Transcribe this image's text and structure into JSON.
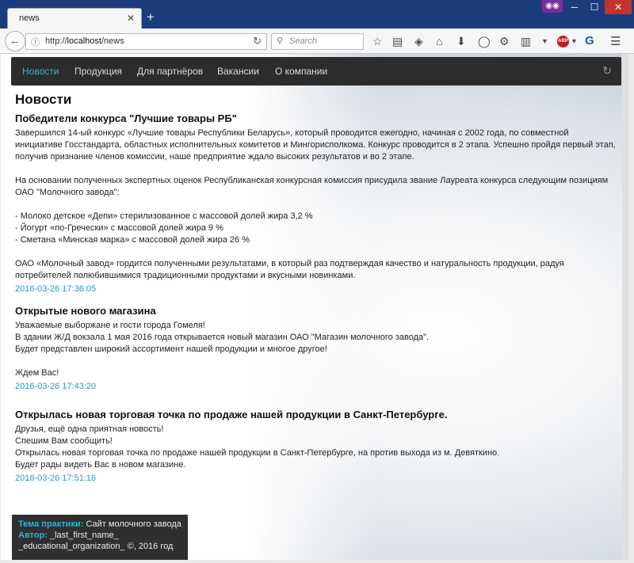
{
  "browser": {
    "tab_title": "news",
    "tab_close": "✕",
    "new_tab": "+",
    "url_prefix": "http://",
    "url_host": "localhost",
    "url_path": "/news",
    "search_placeholder": "Search"
  },
  "site": {
    "nav": [
      {
        "label": "Новости"
      },
      {
        "label": "Продукция"
      },
      {
        "label": "Для партнёров"
      },
      {
        "label": "Вакансии"
      },
      {
        "label": "О компании"
      }
    ],
    "page_title": "Новости",
    "articles": [
      {
        "title": "Победители конкурса \"Лучшие товары РБ\"",
        "body": "Завершился 14-ый конкурс «Лучшие товары Республики Беларусь», который проводится ежегодно, начиная с 2002 года, по совместной инициативе Госстандарта, областных исполнительных комитетов и Мингорисполкома. Конкурс проводится в 2 этапа. Успешно пройдя первый этап, получив признание членов комиссии, наше предприятие ждало высоких результатов и во 2 этапе.\n\nНа основании полученных экспертных оценок Республиканская конкурсная комиссия присудила звание Лауреата конкурса следующим позициям ОАО \"Молочного завода\":\n\n- Молоко детское «Депи» стерилизованное с массовой долей жира 3,2 %\n- Йогурт «по-Гречески» с массовой долей жира 9 %\n- Сметана «Минская марка» с массовой долей жира 26 %\n\nОАО «Молочный завод» гордится полученными результатами, в который раз подтверждая качество и натуральность продукции, радуя потребителей полюбившимися традиционными продуктами и вкусными новинками.",
        "date": "2016-03-26 17:36:05"
      },
      {
        "title": "Открытые нового магазина",
        "body": "Уважаемые выборжане и гости города Гомеля!\nВ здании Ж/Д вокзала 1 мая 2016 года открывается новый магазин ОАО \"Магазин молочного завода\".\nБудет представлен широкий ассортимент нашей продукции и многое другое!\n\nЖдем Вас!",
        "date": "2016-03-26 17:43:20"
      },
      {
        "title": "Открылась новая торговая точка по продаже нашей продукции в Санкт-Петербурге.",
        "body": "Друзья, ещё одна приятная новость!\nСпешим Вам сообщить!\nОткрылась новая торговая точка по продаже нашей продукции в Санкт-Петербурге, на против выхода из м. Девяткино.\nБудет рады видеть Вас в новом магазине.",
        "date": "2016-03-26 17:51:16"
      }
    ],
    "footer": {
      "topic_label": "Тема практики:",
      "topic_value": "Сайт молочного завода",
      "author_label": "Автор:",
      "author_value": "_last_first_name_",
      "org_line": "_educational_organization_ ©, 2016 год"
    }
  }
}
